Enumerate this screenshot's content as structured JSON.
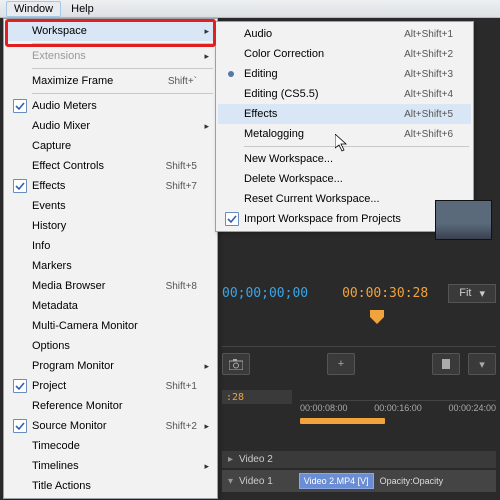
{
  "menubar": {
    "window": "Window",
    "help": "Help"
  },
  "menu1": {
    "workspace": "Workspace",
    "extensions": "Extensions",
    "maximize": "Maximize Frame",
    "maximize_sc": "Shift+`",
    "audio_meters": "Audio Meters",
    "audio_mixer": "Audio Mixer",
    "capture": "Capture",
    "effect_controls": "Effect Controls",
    "effect_controls_sc": "Shift+5",
    "effects": "Effects",
    "effects_sc": "Shift+7",
    "events": "Events",
    "history": "History",
    "info": "Info",
    "markers": "Markers",
    "media_browser": "Media Browser",
    "media_browser_sc": "Shift+8",
    "metadata": "Metadata",
    "multicam": "Multi-Camera Monitor",
    "options": "Options",
    "program_monitor": "Program Monitor",
    "project": "Project",
    "project_sc": "Shift+1",
    "reference": "Reference Monitor",
    "source_monitor": "Source Monitor",
    "source_sc": "Shift+2",
    "timecode": "Timecode",
    "timelines": "Timelines",
    "title_actions": "Title Actions"
  },
  "menu2": {
    "audio": "Audio",
    "audio_sc": "Alt+Shift+1",
    "color": "Color Correction",
    "color_sc": "Alt+Shift+2",
    "editing": "Editing",
    "editing_sc": "Alt+Shift+3",
    "editing55": "Editing (CS5.5)",
    "editing55_sc": "Alt+Shift+4",
    "effects": "Effects",
    "effects_sc": "Alt+Shift+5",
    "metalogging": "Metalogging",
    "meta_sc": "Alt+Shift+6",
    "new_ws": "New Workspace...",
    "delete_ws": "Delete Workspace...",
    "reset_ws": "Reset Current Workspace...",
    "import_ws": "Import Workspace from Projects"
  },
  "panel": {
    "tc_in": "00;00;00;00",
    "tc_out": "00:00:30:28",
    "fit": "Fit",
    "seq_tc": ":28",
    "ruler": [
      "00:00:08:00",
      "00:00:16:00",
      "00:00:24:00"
    ],
    "track_v2": "Video 2",
    "track_v1": "Video 1",
    "clip": "Video 2.MP4 [V]",
    "opacity": "Opacity:Opacity"
  }
}
